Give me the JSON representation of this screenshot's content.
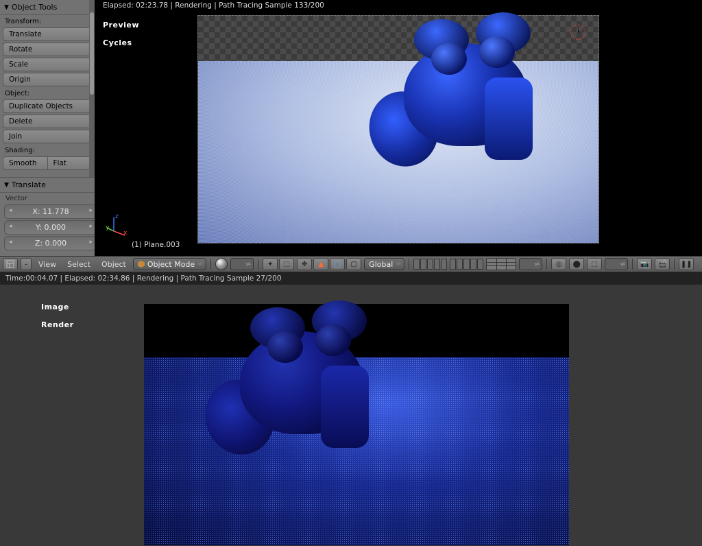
{
  "tool_shelf": {
    "panel_title": "Object Tools",
    "transform_title": "Transform:",
    "translate": "Translate",
    "rotate": "Rotate",
    "scale": "Scale",
    "origin": "Origin",
    "object_title": "Object:",
    "duplicate": "Duplicate Objects",
    "delete": "Delete",
    "join": "Join",
    "shading_title": "Shading:",
    "smooth": "Smooth",
    "flat": "Flat"
  },
  "translate_panel": {
    "title": "Translate",
    "vector_label": "Vector",
    "x": "X: 11.778",
    "y": "Y: 0.000",
    "z": "Z: 0.000"
  },
  "viewport": {
    "status": "Elapsed: 02:23.78 | Rendering | Path Tracing Sample 133/200",
    "overlay_l1": "Preview",
    "overlay_l2": "Cycles",
    "object_name": "(1)  Plane.003",
    "axis": {
      "x": "x",
      "y": "y",
      "z": "z"
    }
  },
  "header": {
    "menu_view": "View",
    "menu_select": "Select",
    "menu_object": "Object",
    "mode": "Object Mode",
    "orientation": "Global"
  },
  "image_editor": {
    "status": "Time:00:04.07 | Elapsed: 02:34.86 | Rendering | Path Tracing Sample 27/200",
    "overlay_l1": "Image",
    "overlay_l2": "Render"
  }
}
